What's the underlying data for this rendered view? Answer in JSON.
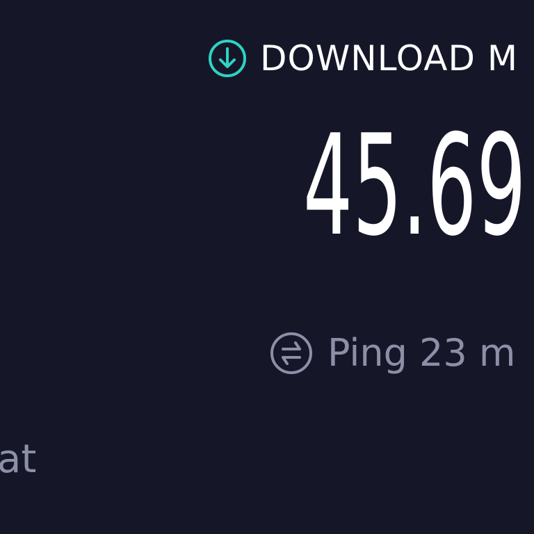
{
  "download": {
    "label": "DOWNLOAD M",
    "icon": "arrow-down-circle-icon",
    "accent_color": "#2ed3c5"
  },
  "speed": {
    "value": "45.69"
  },
  "ping": {
    "icon": "ping-arrows-circle-icon",
    "text": "Ping 23 m",
    "color": "#8c8fa6"
  },
  "left_fragment": {
    "text": "at"
  },
  "theme": {
    "background": "#151729",
    "text_primary": "#ffffff",
    "text_secondary": "#8c8fa6"
  }
}
